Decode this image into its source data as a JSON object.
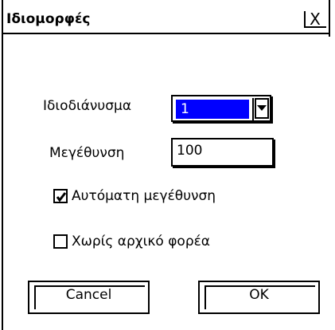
{
  "dialog": {
    "title": "Ιδιομορφές",
    "close_glyph": "X"
  },
  "form": {
    "eigenvector_label": "Ιδιοδιάνυσμα",
    "eigenvector_value": "1",
    "zoom_label": "Μεγέθυνση",
    "zoom_value": "100",
    "auto_zoom_label": "Αυτόματη μεγέθυνση",
    "auto_zoom_checked": true,
    "no_initial_carrier_label": "Χωρίς αρχικό φορέα",
    "no_initial_carrier_checked": false
  },
  "buttons": {
    "cancel_label": "Cancel",
    "ok_label": "OK"
  },
  "icons": {
    "close": "close-icon",
    "dropdown": "chevron-down-icon",
    "check": "check-icon"
  },
  "colors": {
    "selection": "#0000ff",
    "frame": "#000000",
    "background": "#ffffff"
  }
}
